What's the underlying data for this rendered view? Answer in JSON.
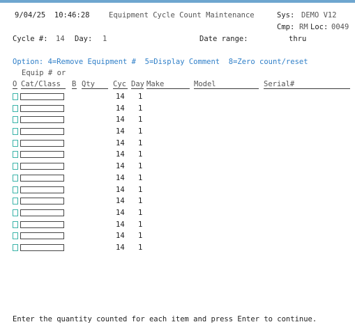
{
  "header": {
    "datetime": "9/04/25  10:46:28",
    "screen_title": "Equipment Cycle Count Maintenance",
    "sys_label": "Sys:",
    "sys_value": "DEMO V12",
    "cmp_label": "Cmp:",
    "cmp_value": "RM",
    "loc_label": "Loc:",
    "loc_value": "0049",
    "cycle_label": "Cycle #:",
    "cycle_value": "14",
    "day_label": "Day:",
    "day_value": "1",
    "date_range_label": "Date range:",
    "thru_label": "thru"
  },
  "options_line": "Option: 4=Remove Equipment #  5=Display Comment  8=Zero count/reset",
  "columns": {
    "equip_prefix": "Equip # or",
    "o": "O",
    "cat_class": "Cat/Class",
    "b": "B",
    "qty": "Qty",
    "cyc": "Cyc",
    "day": "Day",
    "make": "Make",
    "model": "Model",
    "serial": "Serial#"
  },
  "rows": [
    {
      "cyc": "14",
      "day": "1"
    },
    {
      "cyc": "14",
      "day": "1"
    },
    {
      "cyc": "14",
      "day": "1"
    },
    {
      "cyc": "14",
      "day": "1"
    },
    {
      "cyc": "14",
      "day": "1"
    },
    {
      "cyc": "14",
      "day": "1"
    },
    {
      "cyc": "14",
      "day": "1"
    },
    {
      "cyc": "14",
      "day": "1"
    },
    {
      "cyc": "14",
      "day": "1"
    },
    {
      "cyc": "14",
      "day": "1"
    },
    {
      "cyc": "14",
      "day": "1"
    },
    {
      "cyc": "14",
      "day": "1"
    },
    {
      "cyc": "14",
      "day": "1"
    },
    {
      "cyc": "14",
      "day": "1"
    }
  ],
  "footer_message": "Enter the quantity counted for each item and press Enter to continue.",
  "colors": {
    "accent_bar": "#6ea6cf",
    "option_text": "#2f7fc8",
    "checkbox_border": "#3ab3a8"
  }
}
